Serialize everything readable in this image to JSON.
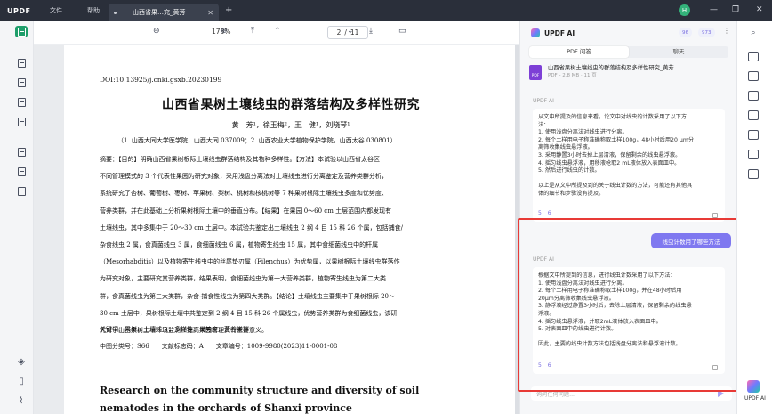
{
  "titlebar": {
    "logo": "UPDF",
    "menu": [
      "文件",
      "帮助"
    ],
    "tab_title": "山西省果…究_黄芳",
    "new_tab": "+",
    "avatar_letter": "H"
  },
  "toolbar": {
    "zoom": "173%",
    "page_current": "2",
    "page_sep": "/",
    "page_total": "11"
  },
  "document": {
    "doi": "DOI:10.13925/j.cnki.gsxb.20230199",
    "title_zh": "山西省果树土壤线虫的群落结构及多样性研究",
    "authors": "黄　芳¹，徐玉梅²，王　健¹，刘晓琴¹",
    "affiliation": "（1. 山西大同大学医学院，山西大同 037009；2. 山西农业大学植物保护学院，山西太谷 030801）",
    "abstract_lines": [
      "摘要：【目的】明确山西省果树根际土壤线虫群落结构及其物种多样性。【方法】本试验以山西省太谷区",
      "不同管理模式的 3 个代表性果园为研究对象，采用浅盘分离法对土壤线虫进行分离鉴定及营养类群分析，",
      "系统研究了杏树、葡萄树、枣树、苹果树、梨树、桃树和核桃树等 7 种果树根际土壤线虫多度和优势度、",
      "营养类群，并在此基础上分析果树根际土壤中的垂直分布。【结果】在果园 0～60 cm 土层范围内都发现有",
      "土壤线虫，其中多集中于 20～30 cm 土层中。本试验共鉴定出土壤线虫 2 纲 4 目 15 科 26 个属，包括捕食/",
      "杂食线虫 2 属，食真菌线虫 3 属，食细菌线虫 6 属，植物寄生线虫 15 属，其中食细菌线虫中的杆属",
      "（Mesorhabditis）以及植物寄生线虫中的丝尾垫刃属（Filenchus）为优势属，以果树根际土壤线虫群落作",
      "为研究对象，主要研究其营养类群，结果表明，食细菌线虫为第一大营养类群，植物寄生线虫为第二大类",
      "群，食真菌线虫为第三大类群，杂食-捕食性线虫为第四大类群。【结论】土壤线虫主要集中于果树根际 20～",
      "30 cm 土层中，果树根际土壤中共鉴定到 2 纲 4 目 15 科 26 个属线虫，优势营养类群为食细菌线虫，该研",
      "究对于山西果树土壤环境监测和提高果园管理具有重要意义。"
    ],
    "keywords": "关键词：果树；土壤线虫；多样性；优势度；营养类群",
    "classification": "中图分类号：S66　　文献标志码：A　　文章编号：1009-9980(2023)11-0001-08",
    "title_en": "Research on the community structure and diversity of soil nematodes in the orchards of Shanxi province"
  },
  "ai_panel": {
    "title": "UPDF AI",
    "badge_a": "96",
    "badge_b": "973",
    "tab_pdf": "PDF 问答",
    "tab_chat": "聊天",
    "file_name": "山西省果树土壤线虫的群落结构及多样性研究_黄芳",
    "file_meta": "PDF - 2.8 MB · 11 页",
    "file_icon_text": "PDF",
    "label_ai": "UPDF AI",
    "answer1_lines": [
      "从文中所提及的信息来看，论文中对线虫的计数采用了以下方",
      "法：",
      "1. 使用浅盘分离法对线虫进行分离。",
      "2. 每个土样用电子称准确称取土样100g，48小时后用20 μm分",
      "离筛收集线虫悬浮液。",
      "3. 采用静置3小时去掉上层清液，保留剩余的线虫悬浮液。",
      "4. 摇匀线虫悬浮液，用移液枪取2 mL液体放入表面皿中。",
      "5. 然后进行线虫的计数。",
      "",
      "以上是从文中所提及到的关于线虫计数的方法，可能还有其他具",
      "体的细节和步骤没有提及。"
    ],
    "answer1_refs": [
      "5",
      "6"
    ],
    "user_question": "线虫计数用了哪些方法",
    "answer2_lines": [
      "根据文中所提到的信息，进行线虫计数采用了以下方法：",
      "1. 使用浅盘分离法对线虫进行分离。",
      "2. 每个土样用电子称准确称取土样100g，并在48小时后用",
      "20μm分离筛收集线虫悬浮液。",
      "3. 静浮液经过静置3小时后，去除上层清液，保留剩余的线虫悬",
      "浮液。",
      "4. 摇匀线虫悬浮液，并取2mL液体放入表面皿中。",
      "5. 对表面皿中的线虫进行计数。",
      "",
      "因此，主要的线虫计数方法包括浅盘分离法和悬浮液计数。"
    ],
    "answer2_refs": [
      "5",
      "6"
    ],
    "input_placeholder": "询问任何问题..."
  },
  "right_rail": {
    "ai_label": "UPDF AI"
  },
  "colors": {
    "titlebar": "#2a2f3a",
    "accent_green": "#1e9e6a",
    "ai_purple": "#7f78f0",
    "highlight_red": "#e83a36"
  },
  "icons": [
    "search-icon",
    "grid-icon",
    "note-icon",
    "edit-icon",
    "page-icon",
    "crop-icon",
    "form-icon",
    "sign-icon",
    "layers-icon",
    "bookmark-icon",
    "attachment-icon",
    "convert-icon",
    "ocr-icon",
    "protect-icon",
    "share-icon",
    "mail-icon",
    "save-icon"
  ]
}
